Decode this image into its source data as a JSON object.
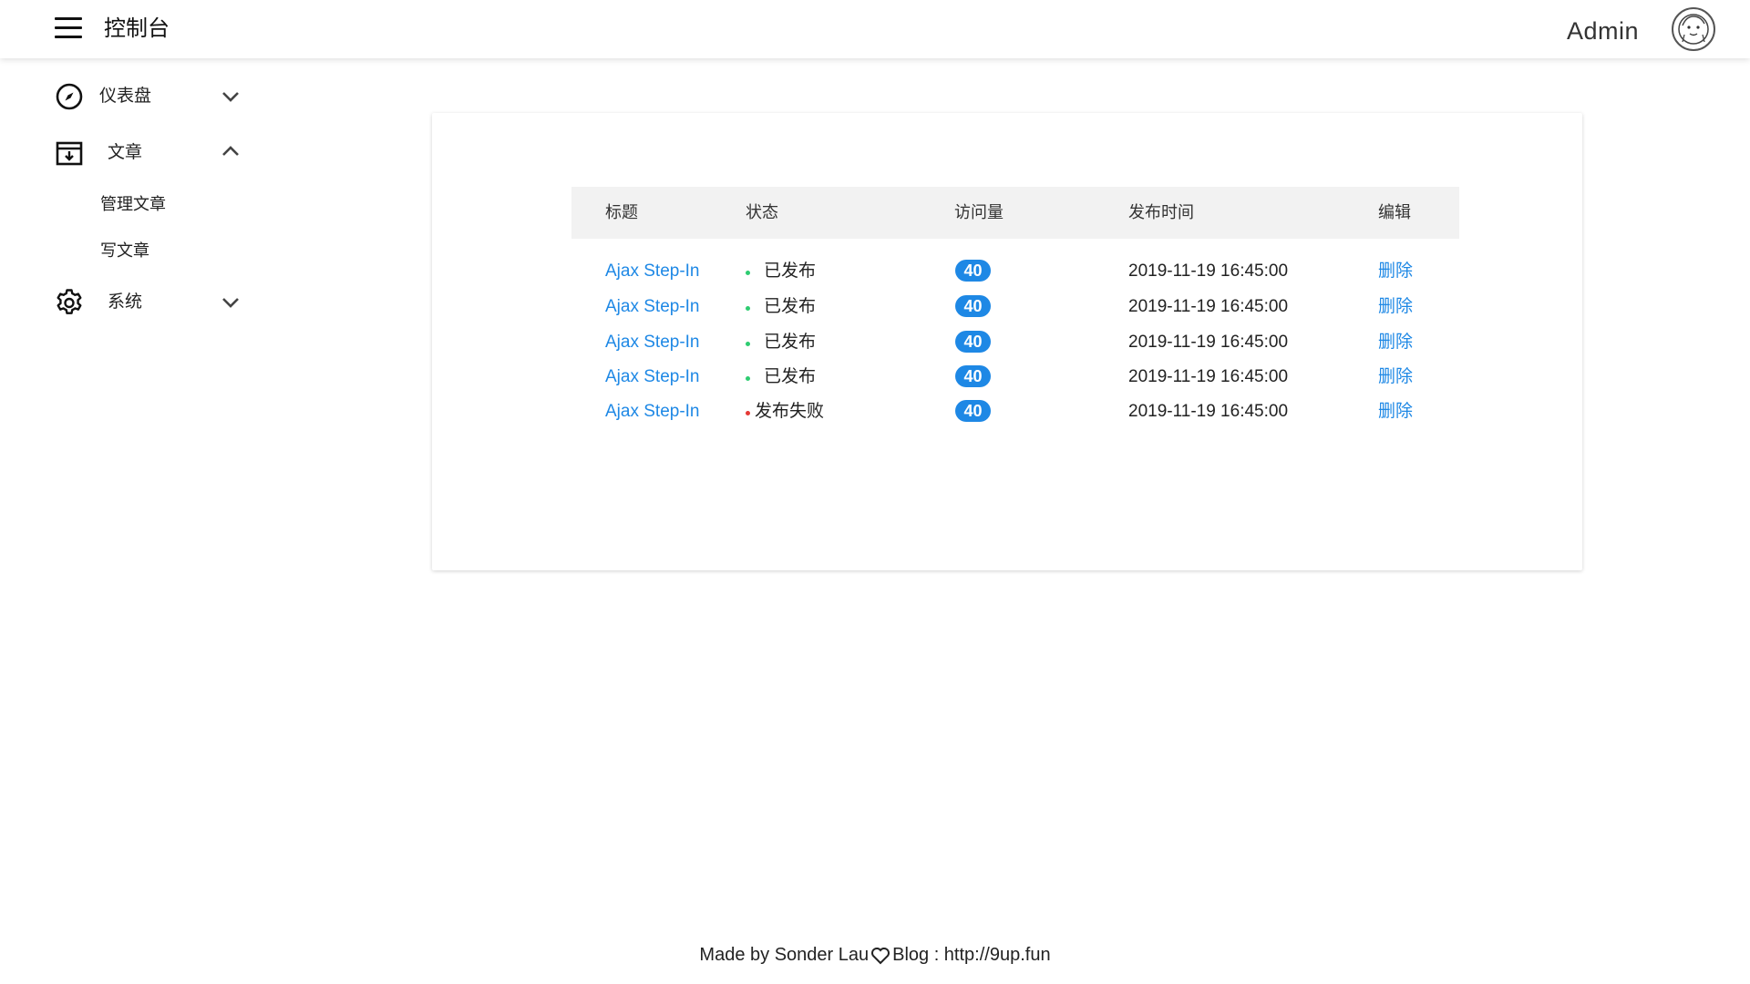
{
  "header": {
    "title": "控制台",
    "admin_name": "Admin"
  },
  "sidebar": {
    "items": [
      {
        "label": "仪表盘",
        "icon": "compass-icon",
        "expanded": false
      },
      {
        "label": "文章",
        "icon": "archive-icon",
        "expanded": true,
        "children": [
          {
            "label": "管理文章"
          },
          {
            "label": "写文章"
          }
        ]
      },
      {
        "label": "系统",
        "icon": "gear-icon",
        "expanded": false
      }
    ]
  },
  "table": {
    "columns": [
      "标题",
      "状态",
      "访问量",
      "发布时间",
      "编辑"
    ],
    "rows": [
      {
        "title": "Ajax Step-In",
        "status": "已发布",
        "status_color": "#2ecc71",
        "views": "40",
        "time": "2019-11-19 16:45:00",
        "action": "删除"
      },
      {
        "title": "Ajax Step-In",
        "status": "已发布",
        "status_color": "#2ecc71",
        "views": "40",
        "time": "2019-11-19 16:45:00",
        "action": "删除"
      },
      {
        "title": "Ajax Step-In",
        "status": "已发布",
        "status_color": "#2ecc71",
        "views": "40",
        "time": "2019-11-19 16:45:00",
        "action": "删除"
      },
      {
        "title": "Ajax Step-In",
        "status": "已发布",
        "status_color": "#2ecc71",
        "views": "40",
        "time": "2019-11-19 16:45:00",
        "action": "删除"
      },
      {
        "title": "Ajax Step-In",
        "status": "发布失败",
        "status_color": "#e53935",
        "views": "40",
        "time": "2019-11-19 16:45:00",
        "action": "删除"
      }
    ]
  },
  "footer": {
    "made_by": "Made by Sonder Lau",
    "blog": "Blog : http://9up.fun"
  },
  "colors": {
    "accent": "#1e88e5",
    "status_ok": "#2ecc71",
    "status_fail": "#e53935"
  }
}
